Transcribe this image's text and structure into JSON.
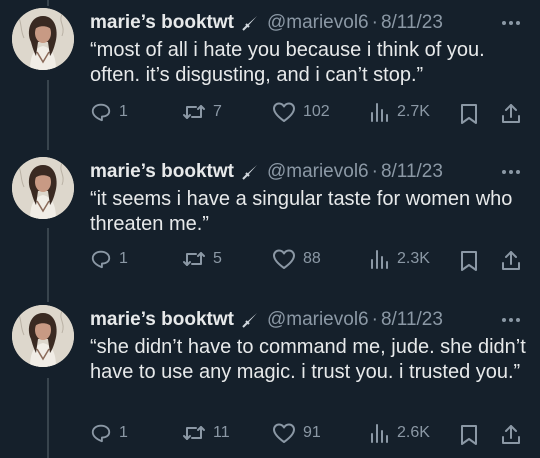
{
  "colors": {
    "background": "#15202b",
    "primary_text": "#e7e9ea",
    "secondary_text": "#8b98a5",
    "thread_line": "#38444d"
  },
  "icons": {
    "reply": "reply-icon",
    "retweet": "retweet-icon",
    "like": "heart-icon",
    "views": "views-icon",
    "bookmark": "bookmark-icon",
    "share": "share-icon",
    "more": "more-icon",
    "badge": "dagger-icon"
  },
  "tweets": [
    {
      "name": "marie’s booktwt",
      "handle": "@marievol6",
      "separator": "·",
      "date": "8/11/23",
      "text": "“most of all i hate you because i think of you. often. it’s disgusting, and i can’t stop.”",
      "replies": "1",
      "retweets": "7",
      "likes": "102",
      "views": "2.7K"
    },
    {
      "name": "marie’s booktwt",
      "handle": "@marievol6",
      "separator": "·",
      "date": "8/11/23",
      "text": "“it seems i have a singular taste for women who threaten me.”",
      "replies": "1",
      "retweets": "5",
      "likes": "88",
      "views": "2.3K"
    },
    {
      "name": "marie’s booktwt",
      "handle": "@marievol6",
      "separator": "·",
      "date": "8/11/23",
      "text": "“she didn’t have to command me, jude. she didn’t have to use any magic. i trust you. i trusted you.”",
      "replies": "1",
      "retweets": "11",
      "likes": "91",
      "views": "2.6K"
    }
  ]
}
